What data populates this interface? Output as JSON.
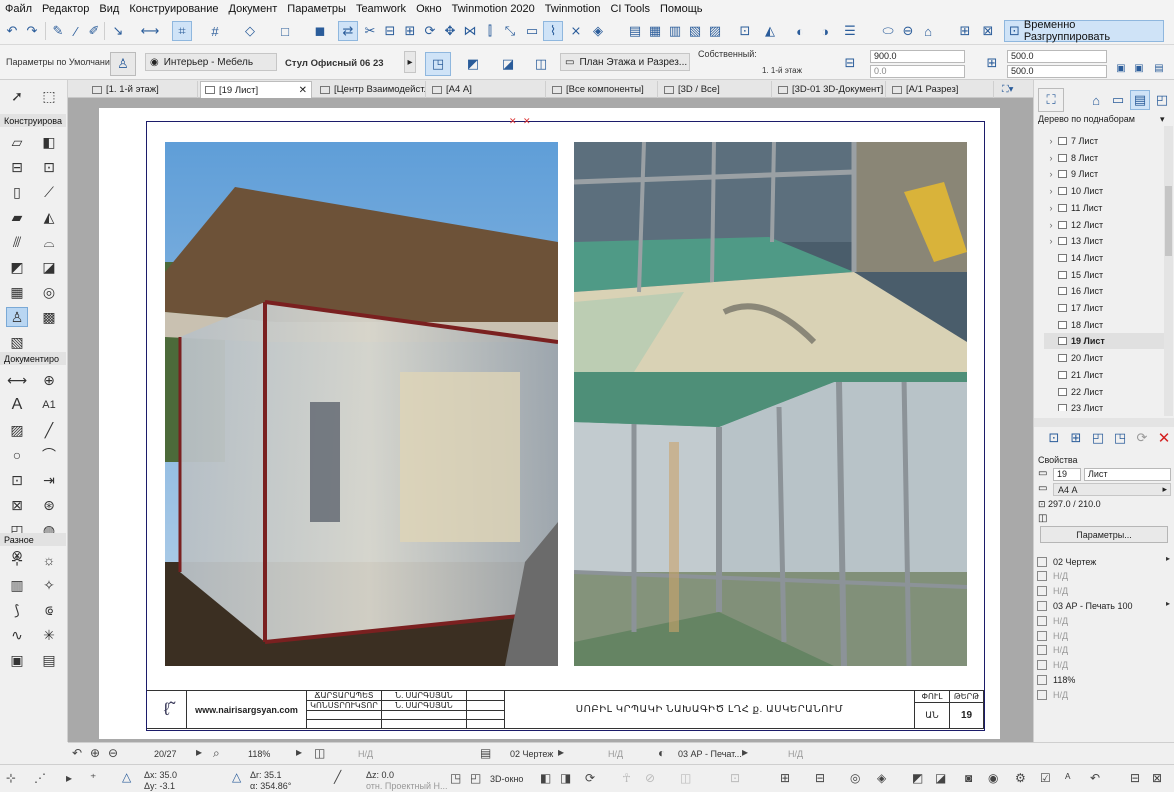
{
  "menu": [
    "Файл",
    "Редактор",
    "Вид",
    "Конструирование",
    "Документ",
    "Параметры",
    "Teamwork",
    "Окно",
    "Twinmotion 2020",
    "Twinmotion",
    "CI Tools",
    "Помощь"
  ],
  "toolbar": {
    "regroup_label": "Временно Разгруппировать"
  },
  "infobox": {
    "preset": "Параметры по Умолчанию",
    "layer": "Интерьер - Мебель",
    "object_name": "Стул Офисный 06 23",
    "view": "План Этажа и Разрез...",
    "own_label": "Собственный:",
    "story": "1. 1-й этаж",
    "elev1": "900.0",
    "elev2": "0.0",
    "size_a": "500.0",
    "size_b": "500.0"
  },
  "tabs": [
    "[1. 1-й этаж]",
    "[19 Лист]",
    "[Центр Взаимодейст...",
    "[А4 А]",
    "[Все компоненты]",
    "[3D / Все]",
    "[3D-01 3D-Документ]",
    "[А/1 Разрез]"
  ],
  "toolbox": {
    "section_construct": "Конструирова",
    "section_document": "Документиро",
    "section_misc": "Разное",
    "text_tool": "A",
    "label_tool": "A1"
  },
  "sheet": {
    "website": "www.nairisargsyan.com",
    "role1": "ՃԱՐՏԱՐԱՊԵՏ",
    "name1": "Ն. ՍԱՐԳՍՅԱՆ",
    "role2": "ԿՈՆՍՏՐՈՒԿՏՈՐ",
    "name2": "Ն. ՍԱՐԳՍՅԱՆ",
    "title": "ՍՈԲԻԼ ԿՐՊԱԿԻ ՆԱԽԱԳԻԾ ԼՂՀ ք. ԱՍԿԵՐԱՆՈՒՄ",
    "stage_label": "ՓՈՒԼ",
    "stage_value": "ԱՆ",
    "sheet_label": "ԹԵՐԹ",
    "sheet_value": "19"
  },
  "navigator": {
    "header": "Дерево по поднаборам",
    "items": [
      {
        "label": "7 Лист",
        "expandable": true
      },
      {
        "label": "8 Лист",
        "expandable": true
      },
      {
        "label": "9 Лист",
        "expandable": true
      },
      {
        "label": "10 Лист",
        "expandable": true
      },
      {
        "label": "11 Лист",
        "expandable": true
      },
      {
        "label": "12 Лист",
        "expandable": true
      },
      {
        "label": "13 Лист",
        "expandable": true
      },
      {
        "label": "14 Лист",
        "expandable": false
      },
      {
        "label": "15 Лист",
        "expandable": false
      },
      {
        "label": "16 Лист",
        "expandable": false
      },
      {
        "label": "17 Лист",
        "expandable": false
      },
      {
        "label": "18 Лист",
        "expandable": false
      },
      {
        "label": "19 Лист",
        "expandable": false,
        "selected": true
      },
      {
        "label": "20 Лист",
        "expandable": false
      },
      {
        "label": "21 Лист",
        "expandable": false
      },
      {
        "label": "22 Лист",
        "expandable": false
      },
      {
        "label": "23 Лист",
        "expandable": false
      }
    ]
  },
  "properties": {
    "header": "Свойства",
    "number": "19",
    "name": "Лист",
    "size": "А4 А",
    "dims": "297.0 / 210.0",
    "params_button": "Параметры...",
    "rows": [
      {
        "label": "02 Чертеж",
        "dark": true,
        "arrow": true
      },
      {
        "label": "Н/Д",
        "dark": false
      },
      {
        "label": "Н/Д",
        "dark": false
      },
      {
        "label": "03 АР - Печать 100",
        "dark": true,
        "arrow": true
      },
      {
        "label": "Н/Д",
        "dark": false
      },
      {
        "label": "Н/Д",
        "dark": false
      },
      {
        "label": "Н/Д",
        "dark": false
      },
      {
        "label": "Н/Д",
        "dark": false
      },
      {
        "label": "118%",
        "dark": true
      },
      {
        "label": "Н/Д",
        "dark": false
      }
    ]
  },
  "statusbar": {
    "page": "20/27",
    "zoom": "118%",
    "nd1": "Н/Д",
    "drawing": "02 Чертеж",
    "nd2": "Н/Д",
    "print": "03 АР - Печат...",
    "nd3": "Н/Д"
  },
  "coords": {
    "dx": "Δx: 35.0",
    "dy": "Δy: -3.1",
    "dr": "Δr: 35.1",
    "da": "α: 354.86°",
    "dz": "Δz: 0.0",
    "ref": "отн. Проектный Н...",
    "view3d": "3D-окно"
  },
  "colors": {
    "accent": "#2a5c9a",
    "selection": "#cfe3f7",
    "frame": "#1c1c6a",
    "delete": "#d32020"
  }
}
